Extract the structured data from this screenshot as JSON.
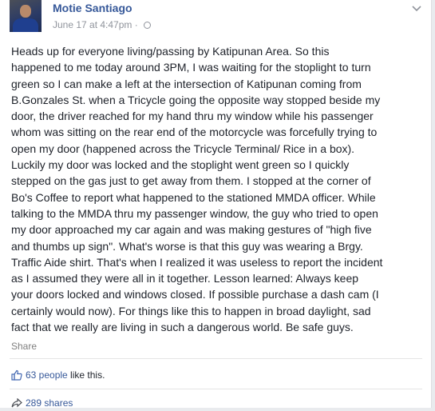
{
  "post": {
    "author": "Motie Santiago",
    "timestamp": "June 17 at 4:47pm",
    "separator": "·",
    "body": "Heads up for everyone living/passing by Katipunan Area. So this\nhappened to me today around 3PM, I was waiting for the stoplight to turn\ngreen so I can make a left at the intersection of Katipunan coming from\nB.Gonzales St. when a Tricycle going the opposite way stopped beside my\ndoor, the driver reached for my hand thru my window while his passenger\nwhom was sitting on the rear end of the motorcycle was forcefully trying to\nopen my door (happened across the Tricycle Terminal/ Rice in a box).\nLuckily my door was locked and the stoplight went green so I quickly\nstepped on the gas just to get away from them. I stopped at the corner of\nBo's Coffee to report what happened to the stationed MMDA officer. While\ntalking to the MMDA thru my passenger window, the guy who tried to open\nmy door approached my car again and was making gestures of \"high five\nand thumbs up sign\". What's worse is that this guy was wearing a Brgy.\nTraffic Aide shirt. That's when I realized it was useless to report the incident\nas I assumed they were all in it together. Lesson learned: Always keep\nyour doors locked and windows closed. If possible purchase a dash cam (I\ncertainly would now). For things like this to happen in broad daylight, sad\nfact that we really are living in such a dangerous world. Be safe guys.",
    "share_label": "Share"
  },
  "reactions": {
    "likes_link": "63 people",
    "likes_suffix": " like this.",
    "shares_label": "289 shares"
  },
  "icons": {
    "privacy": "globe-icon",
    "menu": "chevron-down-icon",
    "like": "thumbs-up-icon",
    "share": "share-arrow-icon"
  },
  "colors": {
    "link": "#365899",
    "meta": "#90949c",
    "text": "#1d2129"
  }
}
